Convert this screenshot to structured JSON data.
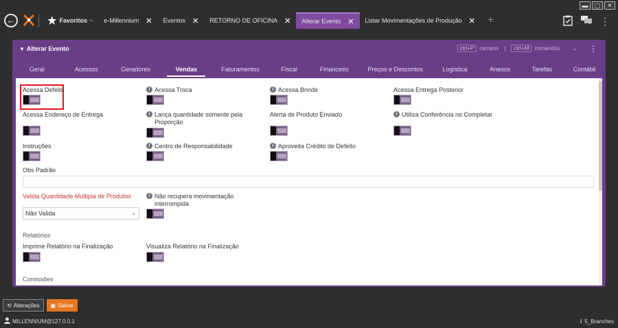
{
  "window": {
    "minimize": "▬",
    "maximize": "▢",
    "close": "✕"
  },
  "tabs": [
    {
      "label": "Favoritos",
      "suffix": "~"
    },
    {
      "label": "e-Millennium"
    },
    {
      "label": "Eventos"
    },
    {
      "label": "RETORNO DE OFICINA"
    },
    {
      "label": "Alterar Evento"
    },
    {
      "label": "Listar Movimentações de Produção"
    }
  ],
  "tab_close": "✕",
  "tab_add": "+",
  "panel": {
    "title": "Alterar Evento",
    "shortcut_fields_key": "ctrl+P",
    "shortcut_fields_label": "campos",
    "shortcut_divider": "|",
    "shortcut_commands_key": "ctrl+M",
    "shortcut_commands_label": "comandos",
    "chevron": "⌄",
    "menu": "⋮"
  },
  "subtabs": [
    "Geral",
    "Acessos",
    "Geradores",
    "Vendas",
    "Faturamentos",
    "Fiscal",
    "Financeiro",
    "Preços e Descontos",
    "Logística",
    "Anexos",
    "Tarefas",
    "Contábil"
  ],
  "fields": {
    "acessa_defeito": "Acessa Defeito",
    "acessa_troca": "Acessa Troca",
    "acessa_brinde": "Acessa Brinde",
    "acessa_entrega_posterior": "Acessa Entrega Posterior",
    "acessa_endereco_entrega": "Acessa Endereço de Entrega",
    "lanca_quantidade_l1": "Lança quantidade somente pela",
    "lanca_quantidade_l2": "Proporção",
    "alerta_produto_enviado": "Alerta de Produto Enviado",
    "utiliza_conferencia": "Utiliza Conferência no Completar",
    "instrucoes": "Instruções",
    "centro_responsabilidade": "Centro de Responsabilidade",
    "aproveita_credito": "Aproveita Crédito de Defeito",
    "obs_padrao": "Obs Padrão",
    "valida_quantidade": "Valida Quantidade Múltipla de Produtos",
    "valida_quantidade_value": "Não Valida",
    "nao_recupera_l1": "Não recupera movimentação",
    "nao_recupera_l2": "interrompida",
    "relatorios_section": "Relatórios",
    "imprime_relatorio": "Imprime Relatório na Finalização",
    "visualiza_relatorio": "Visualiza Relatório na Finalização",
    "comissoes_section": "Comissões"
  },
  "info_glyph": "i",
  "bottom": {
    "alteracoes": "Alterações",
    "salvar": "Salvar",
    "user": "MILLENNIUM@127.0.0.1",
    "branch": "5_Branches"
  },
  "colors": {
    "accent": "#6a3d87",
    "active_tab": "#7f4a9f",
    "save": "#e87722",
    "highlight": "#e0141e"
  }
}
